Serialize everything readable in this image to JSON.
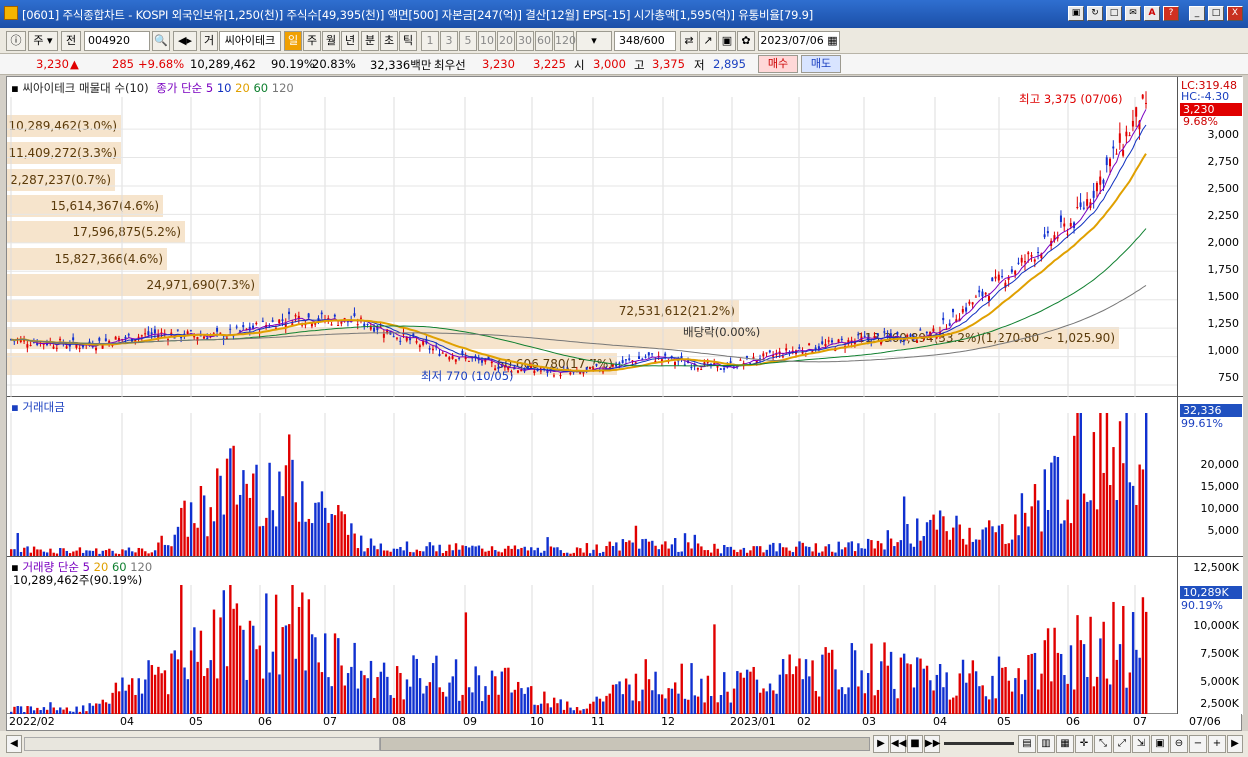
{
  "window": {
    "title": "[0601] 주식종합차트 - KOSPI 외국인보유[1,250(천)] 주식수[49,395(천)] 액면[500] 자본금[247(억)] 결산[12월] EPS[-15] 시가총액[1,595(억)] 유통비율[79.9]",
    "buttons": [
      "▣",
      "↻",
      "□",
      "✉",
      "A",
      "?",
      "_",
      "□",
      "X"
    ]
  },
  "toolbar": {
    "market": "주",
    "prev": "전",
    "code": "004920",
    "search_icon": "magnifier-icon",
    "name_prefix": "거",
    "stock_name": "씨아이테크",
    "periods": [
      "일",
      "주",
      "월",
      "년",
      "분",
      "초",
      "틱"
    ],
    "active_period": "일",
    "intervals": [
      "1",
      "3",
      "5",
      "10",
      "20",
      "30",
      "60",
      "120"
    ],
    "count": "348",
    "count_total": "/600",
    "date": "2023/07/06"
  },
  "quote": {
    "price": "3,230",
    "change_arrow": "▲",
    "change": "285",
    "change_pct": "+9.68%",
    "volume": "10,289,462",
    "vol_ratio": "90.19%",
    "turnover": "20.83%",
    "amount": "32,336백만",
    "best_label": "최우선",
    "ask": "3,230",
    "bid": "3,225",
    "open_label": "시",
    "open": "3,000",
    "high_label": "고",
    "high": "3,375",
    "low_label": "저",
    "low": "2,895",
    "buy": "매수",
    "sell": "매도"
  },
  "price_pane": {
    "legend_main": "씨아이테크 매물대 수(10)",
    "legend_ma": "종가 단순 5",
    "ma": [
      "10",
      "20",
      "60",
      "120"
    ],
    "ma_colors": [
      "#7a00c0",
      "#1030c0",
      "#e0a000",
      "#108030",
      "#777777"
    ],
    "high_note": "최고 3,375 (07/06)",
    "low_note": "최저 770 (10/05)",
    "dividend_note": "배당락(0.00%)",
    "lc": "LC:319.48",
    "hc": "HC:-4.30",
    "cur_tag": "3,230",
    "cur_pct": "9.68%",
    "y_labels": [
      "3,000",
      "2,750",
      "2,500",
      "2,250",
      "2,000",
      "1,750",
      "1,500",
      "1,250",
      "1,000",
      "750"
    ],
    "volume_profile": [
      {
        "label": "10,289,462(3.0%)"
      },
      {
        "label": "11,409,272(3.3%)"
      },
      {
        "label": "2,287,237(0.7%)"
      },
      {
        "label": "15,614,367(4.6%)"
      },
      {
        "label": "17,596,875(5.2%)"
      },
      {
        "label": "15,827,366(4.6%)"
      },
      {
        "label": "24,971,690(7.3%)"
      },
      {
        "label": "72,531,612(21.2%)"
      },
      {
        "label": "113,360,894(33.2%)(1,270.80 ~ 1,025.90)"
      },
      {
        "label": "60,606,780(17.7%)"
      }
    ]
  },
  "amount_pane": {
    "legend": "거래대금",
    "cur_tag": "32,336",
    "cur_pct": "99.61%",
    "y_labels": [
      "20,000",
      "15,000",
      "10,000",
      "5,000"
    ]
  },
  "volume_pane": {
    "legend": "거래량 단순 5",
    "ma": [
      "20",
      "60",
      "120"
    ],
    "value_note": "10,289,462주(90.19%)",
    "cur_tag": "10,289K",
    "cur_pct": "90.19%",
    "y_labels": [
      "12,500K",
      "10,000K",
      "7,500K",
      "5,000K",
      "2,500K"
    ]
  },
  "x_axis": {
    "labels": [
      "2022/02",
      "04",
      "05",
      "06",
      "07",
      "08",
      "09",
      "10",
      "11",
      "12",
      "2023/01",
      "02",
      "03",
      "04",
      "05",
      "06",
      "07"
    ],
    "right_label": "07/06"
  },
  "status": {
    "buttons": [
      "◀",
      "▶",
      "◀◀",
      "■",
      "▶▶"
    ],
    "icons": [
      "zoom-out-icon",
      "zoom-in-icon",
      "plus-icon",
      "minus-icon"
    ]
  },
  "chart_data": [
    {
      "type": "candlestick",
      "title": "씨아이테크 매물대 수(10)",
      "x": [
        "2022/02",
        "04",
        "05",
        "06",
        "07",
        "08",
        "09",
        "10",
        "11",
        "12",
        "2023/01",
        "02",
        "03",
        "04",
        "05",
        "06",
        "07"
      ],
      "close_approx": [
        1150,
        1100,
        1200,
        1180,
        1350,
        1300,
        1050,
        900,
        850,
        1000,
        900,
        1050,
        1150,
        1200,
        1700,
        2200,
        3230
      ],
      "ylim": [
        750,
        3300
      ],
      "high": 3375,
      "low": 770
    },
    {
      "type": "bar",
      "title": "거래대금",
      "x": [
        "2022/02",
        "04",
        "05",
        "06",
        "07",
        "08",
        "09",
        "10",
        "11",
        "12",
        "2023/01",
        "02",
        "03",
        "04",
        "05",
        "06",
        "07"
      ],
      "values": [
        1500,
        1200,
        1100,
        15500,
        16500,
        2500,
        1800,
        1500,
        1200,
        3000,
        1500,
        2000,
        2000,
        6500,
        5000,
        19500,
        32336
      ],
      "ylim": [
        0,
        22000
      ]
    },
    {
      "type": "bar",
      "title": "거래량",
      "x": [
        "2022/02",
        "04",
        "05",
        "06",
        "07",
        "08",
        "09",
        "10",
        "11",
        "12",
        "2023/01",
        "02",
        "03",
        "04",
        "05",
        "06",
        "07"
      ],
      "values": [
        800,
        700,
        5800,
        12300,
        12200,
        5200,
        5200,
        4200,
        800,
        5100,
        4000,
        5300,
        6500,
        5800,
        5000,
        9500,
        10289
      ],
      "ylim": [
        0,
        13000
      ]
    }
  ]
}
